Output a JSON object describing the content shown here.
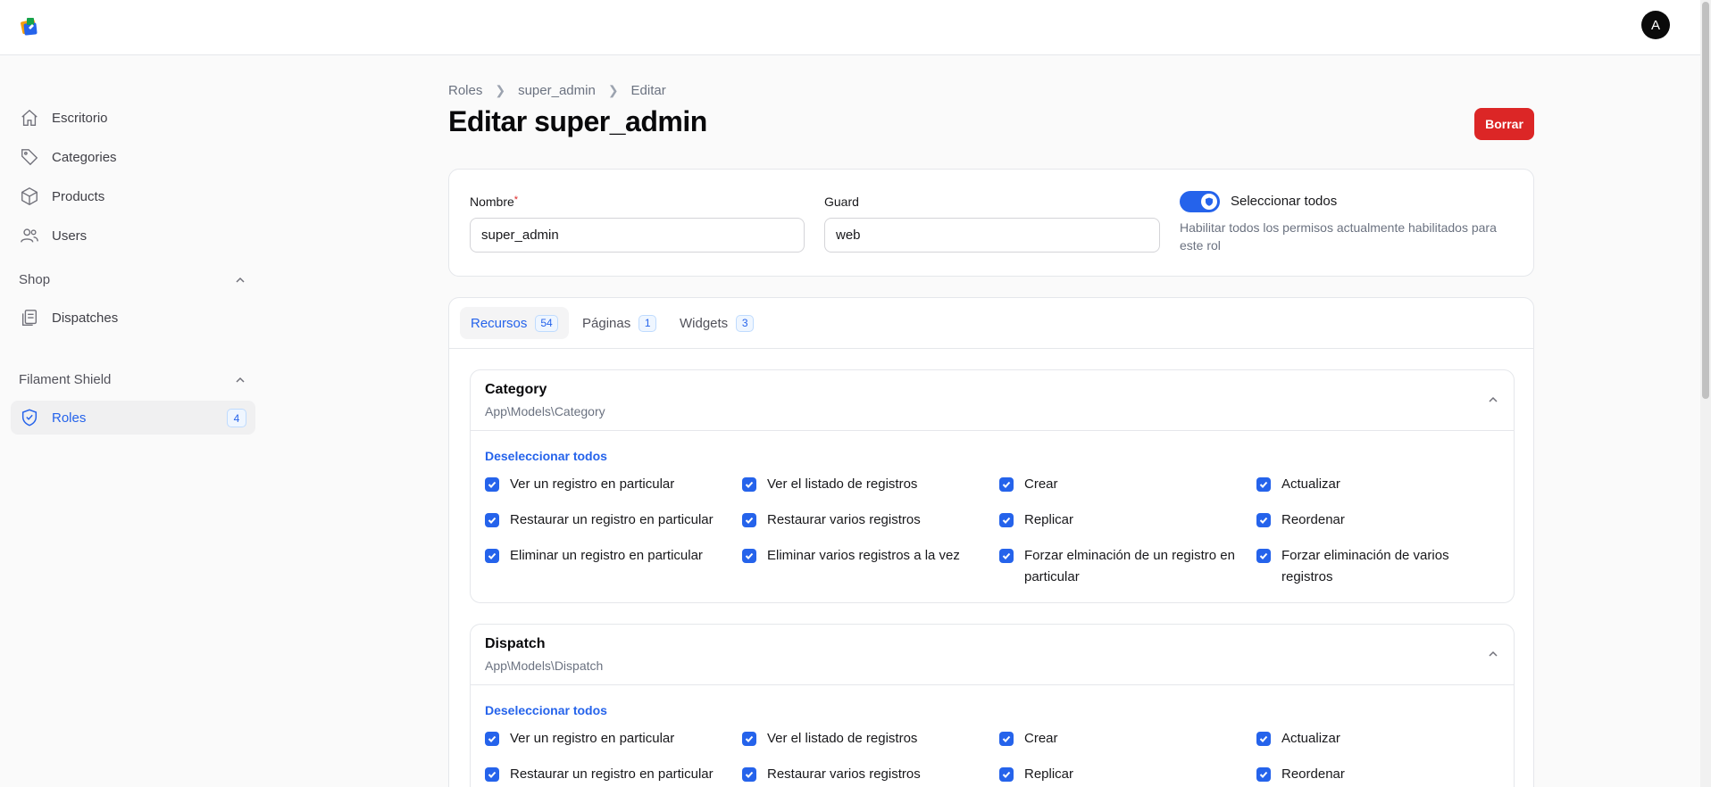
{
  "header": {
    "avatar_initial": "A"
  },
  "sidebar": {
    "items": [
      {
        "label": "Escritorio",
        "icon": "home-icon"
      },
      {
        "label": "Categories",
        "icon": "tag-icon"
      },
      {
        "label": "Products",
        "icon": "cube-icon"
      },
      {
        "label": "Users",
        "icon": "users-icon"
      }
    ],
    "groups": [
      {
        "label": "Shop",
        "items": [
          {
            "label": "Dispatches",
            "icon": "clipboard-icon"
          }
        ]
      },
      {
        "label": "Filament Shield",
        "items": [
          {
            "label": "Roles",
            "icon": "shield-icon",
            "badge": "4",
            "active": true
          }
        ]
      }
    ]
  },
  "breadcrumb": [
    "Roles",
    "super_admin",
    "Editar"
  ],
  "page_title": "Editar super_admin",
  "delete_button": "Borrar",
  "form": {
    "name_label": "Nombre",
    "name_required": "*",
    "name_value": "super_admin",
    "guard_label": "Guard",
    "guard_value": "web",
    "select_all_label": "Seleccionar todos",
    "select_all_help": "Habilitar todos los permisos actualmente habilitados para este rol",
    "select_all_on": true
  },
  "tabs": [
    {
      "label": "Recursos",
      "count": "54",
      "active": true
    },
    {
      "label": "Páginas",
      "count": "1"
    },
    {
      "label": "Widgets",
      "count": "3"
    }
  ],
  "resources": [
    {
      "title": "Category",
      "model": "App\\Models\\Category",
      "deselect_label": "Deseleccionar todos",
      "permissions": [
        "Ver un registro en particular",
        "Ver el listado de registros",
        "Crear",
        "Actualizar",
        "Restaurar un registro en particular",
        "Restaurar varios registros",
        "Replicar",
        "Reordenar",
        "Eliminar un registro en particular",
        "Eliminar varios registros a la vez",
        "Forzar elminación de un registro en particular",
        "Forzar eliminación de varios registros"
      ]
    },
    {
      "title": "Dispatch",
      "model": "App\\Models\\Dispatch",
      "deselect_label": "Deseleccionar todos",
      "permissions": [
        "Ver un registro en particular",
        "Ver el listado de registros",
        "Crear",
        "Actualizar",
        "Restaurar un registro en particular",
        "Restaurar varios registros",
        "Replicar",
        "Reordenar"
      ]
    }
  ],
  "colors": {
    "accent": "#2563eb",
    "danger": "#dc2626"
  }
}
